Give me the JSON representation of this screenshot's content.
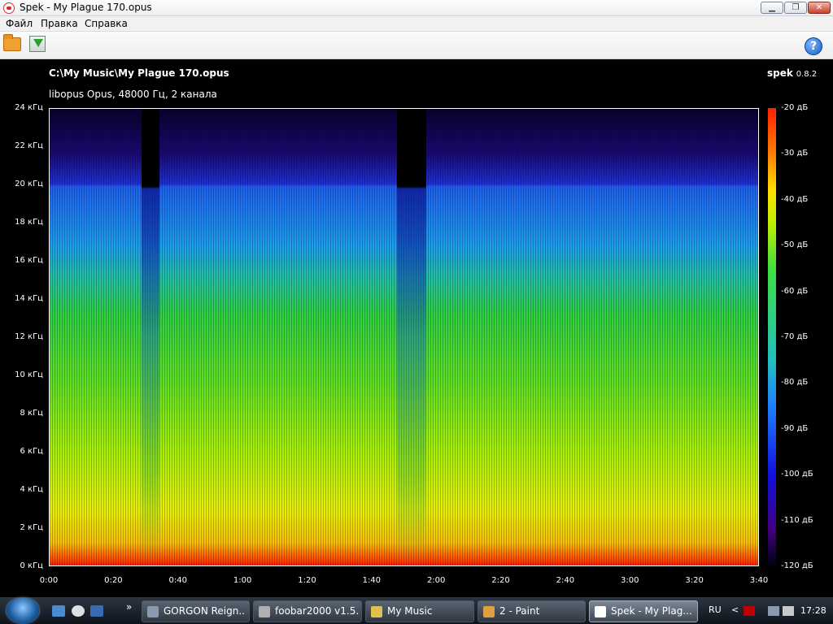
{
  "window": {
    "title": "Spek - My Plague 170.opus",
    "min_glyph": "▁",
    "max_glyph": "❐",
    "close_glyph": "✕"
  },
  "menu": {
    "items": [
      "Файл",
      "Правка",
      "Справка"
    ]
  },
  "toolbar": {
    "open_icon": "folder-open-icon",
    "save_icon": "save-icon",
    "help_icon": "help-icon",
    "help_glyph": "?"
  },
  "spectrogram": {
    "file_path": "C:\\My Music\\My Plague 170.opus",
    "file_info": "libopus Opus, 48000 Гц, 2 канала",
    "brand_name": "spek",
    "brand_version": "0.8.2"
  },
  "chart_data": {
    "type": "heatmap",
    "y_ticks": [
      "24 кГц",
      "22 кГц",
      "20 кГц",
      "18 кГц",
      "16 кГц",
      "14 кГц",
      "12 кГц",
      "10 кГц",
      "8 кГц",
      "6 кГц",
      "4 кГц",
      "2 кГц",
      "0 кГц"
    ],
    "x_ticks": [
      "0:00",
      "0:20",
      "0:40",
      "1:00",
      "1:20",
      "1:40",
      "2:00",
      "2:20",
      "2:40",
      "3:00",
      "3:20",
      "3:40"
    ],
    "colorbar_ticks": [
      "-20 дБ",
      "-30 дБ",
      "-40 дБ",
      "-50 дБ",
      "-60 дБ",
      "-70 дБ",
      "-80 дБ",
      "-90 дБ",
      "-100 дБ",
      "-110 дБ",
      "-120 дБ"
    ],
    "y_range_khz": [
      0,
      24
    ],
    "x_range": [
      "0:00",
      "3:40"
    ],
    "db_range": [
      -120,
      -20
    ],
    "cutoff_khz": 20,
    "colors": {
      "high": "#ff2000",
      "mid": "#40e040",
      "low": "#1010e0",
      "floor": "#000010"
    }
  },
  "taskbar": {
    "items": [
      {
        "label": "GORGON Reign...",
        "icon_color": "#8a9ab0"
      },
      {
        "label": "foobar2000 v1.5...",
        "icon_color": "#b0b0b0"
      },
      {
        "label": "My Music",
        "icon_color": "#e0c050"
      },
      {
        "label": "2 - Paint",
        "icon_color": "#e0a040"
      },
      {
        "label": "Spek - My Plag...",
        "icon_color": "#ffffff"
      }
    ],
    "overflow_glyph": "»",
    "language": "RU",
    "tray_back_glyph": "<",
    "clock": "17:28"
  }
}
